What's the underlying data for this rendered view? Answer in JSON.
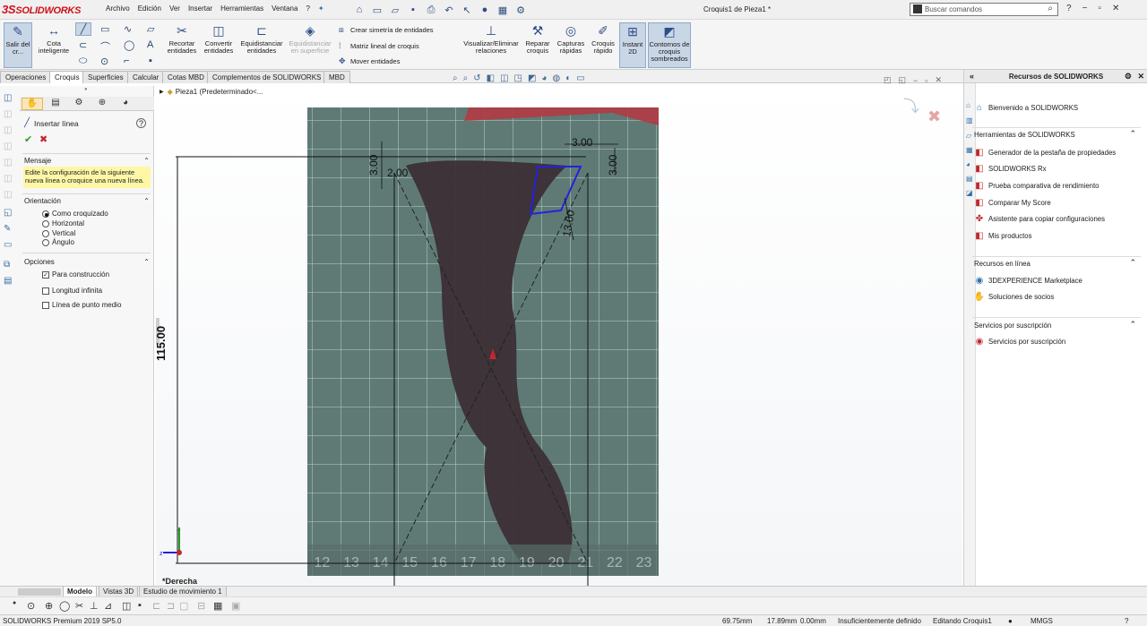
{
  "app": {
    "logo_ds": "3S",
    "logo_solid": "SOLID",
    "logo_works": "WORKS",
    "doc_title": "Croquis1 de Pieza1 *"
  },
  "menus": [
    "Archivo",
    "Edición",
    "Ver",
    "Insertar",
    "Herramientas",
    "Ventana",
    "?"
  ],
  "search": {
    "placeholder": "Buscar comandos"
  },
  "toolbar": {
    "exit_sketch": "Salir del cr...",
    "smart_dim": "Cota inteligente",
    "trim": "Recortar entidades",
    "convert": "Convertir entidades",
    "offset": "Equidistanciar entidades",
    "offset_surface": "Equidistanciar en superficie",
    "mirror": "Crear simetría de entidades",
    "linear_pattern": "Matriz lineal de croquis",
    "move": "Mover entidades",
    "relations": "Visualizar/Eliminar relaciones",
    "repair": "Reparar croquis",
    "quick_snaps": "Capturas rápidas",
    "rapid_sketch": "Croquis rápido",
    "instant2d": "Instant 2D",
    "shaded": "Contornos de croquis sombreados"
  },
  "tabs": [
    "Operaciones",
    "Croquis",
    "Superficies",
    "Calcular",
    "Cotas MBD",
    "Complementos de SOLIDWORKS",
    "MBD"
  ],
  "active_tab": "Croquis",
  "property_manager": {
    "title": "Insertar línea",
    "message_title": "Mensaje",
    "message": "Edite la configuración de la siguiente nueva línea o croquice una nueva línea.",
    "orientation_title": "Orientación",
    "orientation_options": [
      "Como croquizado",
      "Horizontal",
      "Vertical",
      "Ángulo"
    ],
    "orientation_selected": "Como croquizado",
    "options_title": "Opciones",
    "options": [
      {
        "label": "Para construcción",
        "checked": true
      },
      {
        "label": "Longitud infinita",
        "checked": false
      },
      {
        "label": "Línea de punto medio",
        "checked": false
      }
    ]
  },
  "tree": {
    "root": "Pieza1  (Predeterminado<..."
  },
  "viewport": {
    "view_name": "*Derecha",
    "dimensions": {
      "d1": "3.00",
      "d2": "2.00",
      "d3": "3.00",
      "d4": "3.00",
      "d5": "13.00",
      "d6": "115.00"
    },
    "ruler": [
      "12",
      "13",
      "14",
      "15",
      "16",
      "17",
      "18",
      "19",
      "20",
      "21",
      "22",
      "23"
    ]
  },
  "resources": {
    "title": "Recursos de SOLIDWORKS",
    "welcome": "Bienvenido a SOLIDWORKS",
    "tools_title": "Herramientas de SOLIDWORKS",
    "tools": [
      "Generador de la pestaña de propiedades",
      "SOLIDWORKS Rx",
      "Prueba comparativa de rendimiento",
      "Comparar My Score",
      "Asistente para copiar configuraciones",
      "Mis productos"
    ],
    "online_title": "Recursos en línea",
    "online": [
      "3DEXPERIENCE Marketplace",
      "Soluciones de socios"
    ],
    "subscription_title": "Servicios por suscripción",
    "subscription": [
      "Servicios por suscripción"
    ]
  },
  "bottom_tabs": [
    "Modelo",
    "Vistas 3D",
    "Estudio de movimiento 1"
  ],
  "status": {
    "version": "SOLIDWORKS Premium 2019 SP5.0",
    "x": "69.75mm",
    "y": "17.89mm",
    "z": "0.00mm",
    "state": "Insuficientemente definido",
    "editing": "Editando Croquis1",
    "units": "MMGS"
  },
  "colors": {
    "brand": "#d0111b",
    "sketch_blue": "#2222dd",
    "dimension": "#000000",
    "construction": "#222222"
  }
}
